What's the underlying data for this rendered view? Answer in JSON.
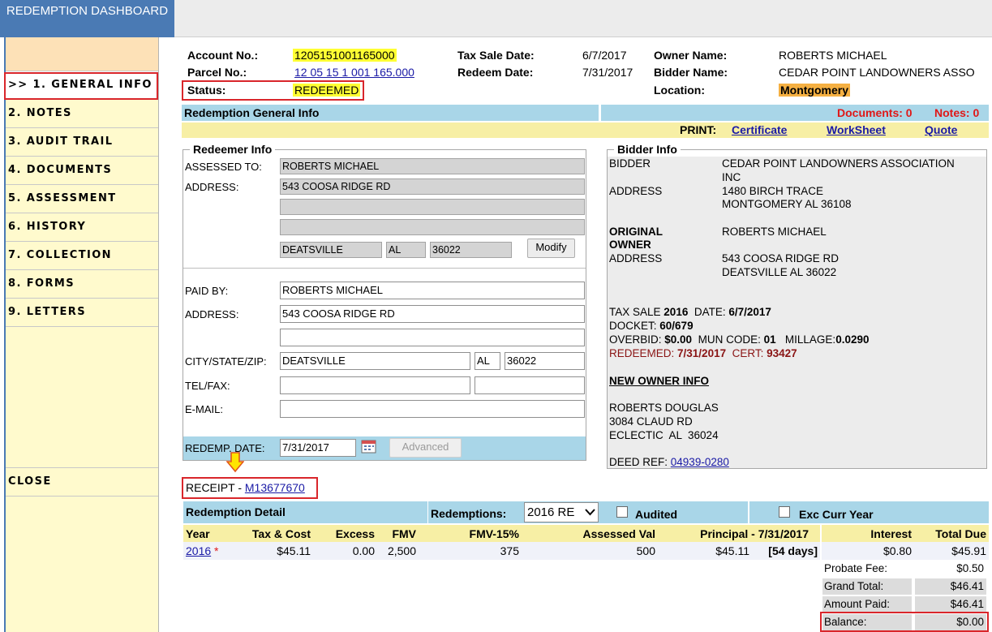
{
  "sidebar": {
    "title": "REDEMPTION DASHBOARD",
    "items": [
      {
        "label": ">> 1. GENERAL INFO"
      },
      {
        "label": "2. NOTES"
      },
      {
        "label": "3. AUDIT TRAIL"
      },
      {
        "label": "4. DOCUMENTS"
      },
      {
        "label": "5. ASSESSMENT"
      },
      {
        "label": "6. HISTORY"
      },
      {
        "label": "7. COLLECTION"
      },
      {
        "label": "8. FORMS"
      },
      {
        "label": "9. LETTERS"
      }
    ],
    "close": "CLOSE"
  },
  "header": {
    "account_label": "Account No.:",
    "account_value": "1205151001165000",
    "parcel_label": "Parcel No.:",
    "parcel_value": "12 05 15 1 001 165.000",
    "status_label": "Status:",
    "status_value": "REDEEMED",
    "tax_sale_label": "Tax Sale Date:",
    "tax_sale_value": "6/7/2017",
    "redeem_label": "Redeem Date:",
    "redeem_value": "7/31/2017",
    "owner_label": "Owner Name:",
    "owner_value": "ROBERTS MICHAEL",
    "bidder_label": "Bidder Name:",
    "bidder_value": "CEDAR POINT LANDOWNERS ASSO",
    "location_label": "Location:",
    "location_value": "Montgomery"
  },
  "general_bar": {
    "title": "Redemption General Info",
    "documents": "Documents: 0",
    "notes": "Notes: 0",
    "print_label": "PRINT:",
    "links": [
      "Certificate",
      "WorkSheet",
      "Quote"
    ]
  },
  "redeemer": {
    "legend": "Redeemer Info",
    "assessed_label": "ASSESSED TO:",
    "assessed_value": "ROBERTS MICHAEL",
    "address_label": "ADDRESS:",
    "address1": "543 COOSA RIDGE RD",
    "address2": "",
    "address3": "",
    "city": "DEATSVILLE",
    "state": "AL",
    "zip": "36022",
    "modify": "Modify",
    "paid_by_label": "PAID BY:",
    "paid_by_value": "ROBERTS MICHAEL",
    "paid_address_label": "ADDRESS:",
    "paid_address1": "543 COOSA RIDGE RD",
    "paid_address2": "",
    "csz_label": "CITY/STATE/ZIP:",
    "paid_city": "DEATSVILLE",
    "paid_state": "AL",
    "paid_zip": "36022",
    "telfax_label": "TEL/FAX:",
    "tel": "",
    "fax": "",
    "email_label": "E-MAIL:",
    "email": "",
    "redemp_date_label": "REDEMP. DATE:",
    "redemp_date": "7/31/2017",
    "advanced": "Advanced"
  },
  "bidder": {
    "legend": "Bidder Info",
    "bidder_label": "BIDDER",
    "bidder_name_1": "CEDAR POINT LANDOWNERS ASSOCIATION",
    "bidder_name_2": "INC",
    "address_label": "ADDRESS",
    "bidder_addr1": "1480 BIRCH TRACE",
    "bidder_addr2": "MONTGOMERY AL 36108",
    "orig_owner_label_1": "ORIGINAL",
    "orig_owner_label_2": "OWNER",
    "orig_owner_name": "ROBERTS MICHAEL",
    "orig_address_label": "ADDRESS",
    "orig_addr1": "543 COOSA RIDGE RD",
    "orig_addr2": "DEATSVILLE AL 36022",
    "tax_sale_label": "TAX SALE",
    "tax_sale_year": "2016",
    "date_label": "DATE:",
    "date_value": "6/7/2017",
    "docket_label": "DOCKET:",
    "docket_value": "60/679",
    "overbid_label": "OVERBID:",
    "overbid_value": "$0.00",
    "mun_label": "MUN CODE:",
    "mun_value": "01",
    "millage_label": "MILLAGE:",
    "millage_value": "0.0290",
    "redeemed_label": "REDEEMED:",
    "redeemed_value": "7/31/2017",
    "cert_label": "CERT:",
    "cert_value": "93427",
    "new_owner_title": "NEW OWNER INFO",
    "new_owner_name": "ROBERTS DOUGLAS",
    "new_owner_addr1": "3084 CLAUD RD",
    "new_owner_addr2": "ECLECTIC  AL  36024",
    "deed_label": "DEED REF:",
    "deed_value": "04939-0280"
  },
  "receipt": {
    "label": "RECEIPT -",
    "value": "M13677670"
  },
  "detail": {
    "title": "Redemption Detail",
    "redemptions_label": "Redemptions:",
    "redemptions_value": "2016 RE",
    "audited_label": "Audited",
    "exc_label": "Exc Curr Year",
    "columns": [
      "Year",
      "Tax & Cost",
      "Excess",
      "FMV",
      "FMV-15%",
      "Assessed Val",
      "Principal - 7/31/2017",
      "Interest",
      "Total Due"
    ],
    "row": {
      "year": "2016",
      "star": "*",
      "tax_cost": "$45.11",
      "excess": "0.00",
      "fmv": "2,500",
      "fmv15": "375",
      "assessed": "500",
      "principal": "$45.11",
      "days": "[54 days]",
      "interest": "$0.80",
      "total": "$45.91"
    },
    "summary": {
      "probate_label": "Probate Fee:",
      "probate_value": "$0.50",
      "grand_label": "Grand Total:",
      "grand_value": "$46.41",
      "paid_label": "Amount Paid:",
      "paid_value": "$46.41",
      "balance_label": "Balance:",
      "balance_value": "$0.00"
    }
  },
  "colors": {
    "sidebar_title": "#4a7ab4",
    "sidebar_bg": "#fffacd",
    "highlight": "#ffff33",
    "location_bg": "#f5b042",
    "bar_blue": "#a9d6e8",
    "bar_yellow": "#f7efa5",
    "annotation_red": "#d9262b",
    "arrow": "#ffe500"
  }
}
